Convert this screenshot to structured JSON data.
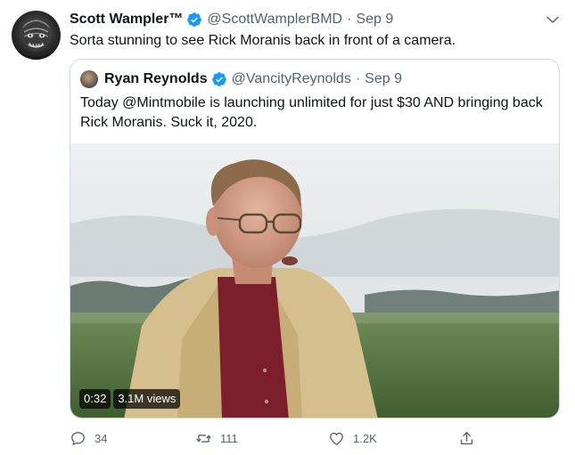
{
  "tweet": {
    "author_name": "Scott Wampler™",
    "author_handle": "@ScottWamplerBMD",
    "separator": "·",
    "date": "Sep 9",
    "text": "Sorta stunning to see Rick Moranis back in front of a camera.",
    "avatar_icon": "creature-avatar",
    "verified_icon": "verified-badge-icon",
    "more_icon": "chevron-down-icon"
  },
  "quoted_tweet": {
    "author_name": "Ryan Reynolds",
    "author_handle": "@VancityReynolds",
    "separator": "·",
    "date": "Sep 9",
    "text": "Today @Mintmobile is launching unlimited for just $30 AND bringing back Rick Moranis. Suck it, 2020.",
    "video": {
      "duration": "0:32",
      "views": "3.1M views"
    }
  },
  "actions": {
    "reply_count": "34",
    "retweet_count": "111",
    "like_count": "1.2K",
    "share_icon": "share-icon"
  },
  "colors": {
    "text_primary": "#0f1419",
    "text_secondary": "#536471",
    "verified_blue": "#1d9bf0",
    "border": "#cfd9de"
  }
}
